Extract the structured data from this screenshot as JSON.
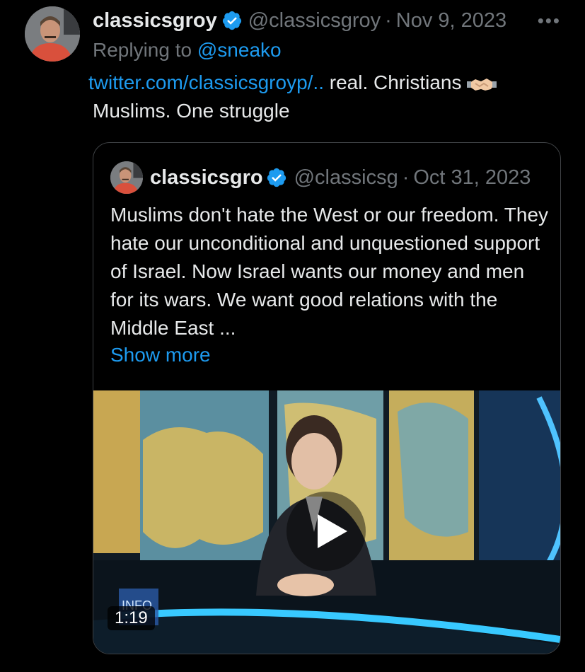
{
  "tweet": {
    "display_name": "classicsgroy",
    "handle": "@classicsgroy",
    "separator": "·",
    "date": "Nov 9, 2023",
    "more_icon": "more-horizontal-icon",
    "reply_prefix": "Replying to",
    "reply_to": "@sneako",
    "link_text": "twitter.com/classicsgroyp/..",
    "text_after_link": " real. Christians ",
    "emoji": "handshake-emoji",
    "text_end": " Muslims. One struggle"
  },
  "quote": {
    "display_name": "classicsgro",
    "handle": "@classicsg",
    "separator": "·",
    "date": "Oct 31, 2023",
    "text": "Muslims don't hate the West or our freedom. They hate our unconditional and unquestioned support of Israel. Now Israel wants our money and men for its wars. We want good relations with the Middle East ...",
    "show_more": "Show more",
    "video": {
      "duration": "1:19",
      "watermark": "INFO"
    }
  },
  "colors": {
    "background": "#000000",
    "text": "#e7e9ea",
    "muted": "#71767b",
    "link": "#1d9bf0",
    "border": "#3e4144"
  }
}
